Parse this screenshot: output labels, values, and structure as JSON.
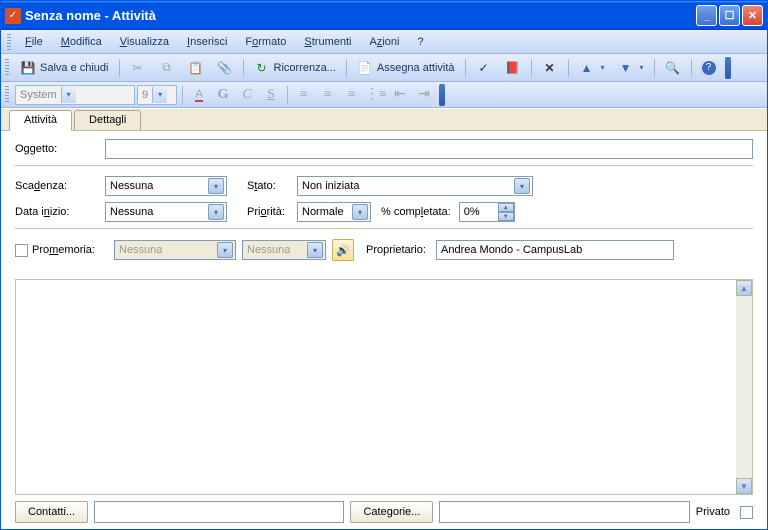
{
  "window": {
    "title": "Senza nome - Attività"
  },
  "menu": {
    "file": "File",
    "modifica": "Modifica",
    "visualizza": "Visualizza",
    "inserisci": "Inserisci",
    "formato": "Formato",
    "strumenti": "Strumenti",
    "azioni": "Azioni",
    "help": "?"
  },
  "toolbar": {
    "save_close": "Salva e chiudi",
    "ricorrenza": "Ricorrenza...",
    "assegna": "Assegna attività"
  },
  "format": {
    "font": "System",
    "size": "9"
  },
  "tabs": {
    "attivita": "Attività",
    "dettagli": "Dettagli"
  },
  "labels": {
    "oggetto": "Oggetto:",
    "scadenza": "Scadenza:",
    "datainizio": "Data inizio:",
    "stato": "Stato:",
    "priorita": "Priorità:",
    "completata": "% completata:",
    "promemoria": "Promemoria:",
    "proprietario": "Proprietario:",
    "privato": "Privato"
  },
  "values": {
    "oggetto": "",
    "scadenza": "Nessuna",
    "datainizio": "Nessuna",
    "stato": "Non iniziata",
    "priorita": "Normale",
    "completata": "0%",
    "prom_date": "Nessuna",
    "prom_time": "Nessuna",
    "proprietario": "Andrea Mondo - CampusLab"
  },
  "buttons": {
    "contatti": "Contatti...",
    "categorie": "Categorie..."
  }
}
